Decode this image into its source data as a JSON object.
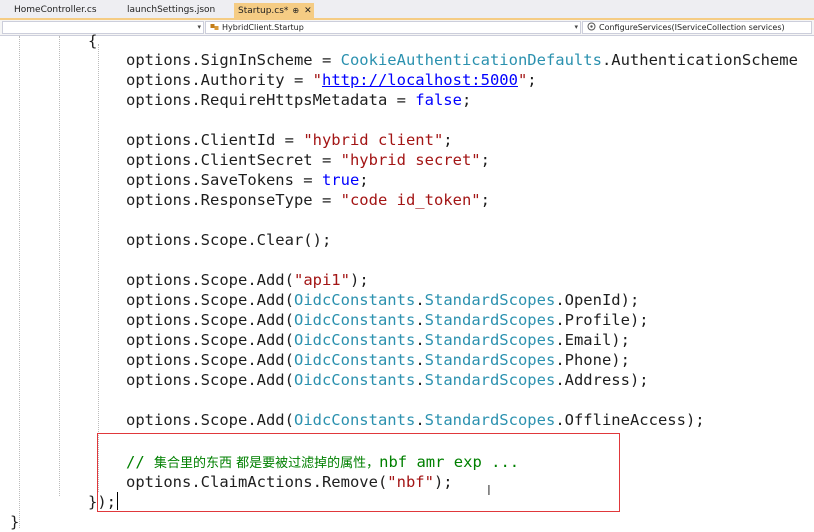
{
  "tabs": [
    {
      "label": "HomeController.cs",
      "active": false
    },
    {
      "label": "launchSettings.json",
      "active": false
    },
    {
      "label": "Startup.cs*",
      "active": true,
      "pin": "⊕",
      "close": "✕"
    }
  ],
  "nav": {
    "project": "",
    "class": "HybridClient.Startup",
    "member": "ConfigureServices(IServiceCollection services)"
  },
  "code": {
    "open_brace": "{",
    "l1": {
      "a": "options.SignInScheme = ",
      "b": "CookieAuthenticationDefaults",
      "c": ".AuthenticationScheme"
    },
    "l2": {
      "a": "options.Authority = ",
      "q1": "\"",
      "b": "http://localhost:5000",
      "q2": "\"",
      "c": ";"
    },
    "l3": {
      "a": "options.RequireHttpsMetadata = ",
      "b": "false",
      "c": ";"
    },
    "l4": {
      "a": "options.ClientId = ",
      "b": "\"hybrid client\"",
      "c": ";"
    },
    "l5": {
      "a": "options.ClientSecret = ",
      "b": "\"hybrid secret\"",
      "c": ";"
    },
    "l6": {
      "a": "options.SaveTokens = ",
      "b": "true",
      "c": ";"
    },
    "l7": {
      "a": "options.ResponseType = ",
      "b": "\"code id_token\"",
      "c": ";"
    },
    "l8": {
      "a": "options.Scope.Clear();"
    },
    "l9": {
      "a": "options.Scope.Add(",
      "b": "\"api1\"",
      "c": ");"
    },
    "l10": {
      "a": "options.Scope.Add(",
      "t1": "OidcConstants",
      "d1": ".",
      "t2": "StandardScopes",
      "c": ".OpenId);"
    },
    "l11": {
      "a": "options.Scope.Add(",
      "t1": "OidcConstants",
      "d1": ".",
      "t2": "StandardScopes",
      "c": ".Profile);"
    },
    "l12": {
      "a": "options.Scope.Add(",
      "t1": "OidcConstants",
      "d1": ".",
      "t2": "StandardScopes",
      "c": ".Email);"
    },
    "l13": {
      "a": "options.Scope.Add(",
      "t1": "OidcConstants",
      "d1": ".",
      "t2": "StandardScopes",
      "c": ".Phone);"
    },
    "l14": {
      "a": "options.Scope.Add(",
      "t1": "OidcConstants",
      "d1": ".",
      "t2": "StandardScopes",
      "c": ".Address);"
    },
    "l15": {
      "a": "options.Scope.Add(",
      "t1": "OidcConstants",
      "d1": ".",
      "t2": "StandardScopes",
      "c": ".OfflineAccess);"
    },
    "comment": {
      "prefix": "// ",
      "cjk": "集合里的东西 都是要被过滤掉的属性，",
      "rest": "nbf amr exp ..."
    },
    "l16": {
      "a": "options.ClaimActions.Remove(",
      "b": "\"nbf\"",
      "c": ");"
    },
    "close_paren": "});",
    "close_brace": "}"
  },
  "colors": {
    "keyword": "#0000ff",
    "type": "#2b91af",
    "string": "#a31515",
    "comment": "#008000",
    "highlight_border": "#e0383b",
    "active_tab": "#f5cc84"
  }
}
